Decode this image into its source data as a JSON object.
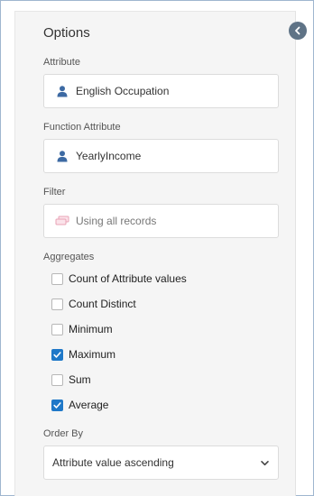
{
  "panel": {
    "title": "Options",
    "attribute": {
      "label": "Attribute",
      "value": "English Occupation",
      "icon": "user-icon"
    },
    "function_attribute": {
      "label": "Function Attribute",
      "value": "YearlyIncome",
      "icon": "user-icon"
    },
    "filter": {
      "label": "Filter",
      "value": "Using all records",
      "icon": "filter-records-icon"
    },
    "aggregates": {
      "label": "Aggregates",
      "items": [
        {
          "label": "Count of Attribute values",
          "checked": false
        },
        {
          "label": "Count Distinct",
          "checked": false
        },
        {
          "label": "Minimum",
          "checked": false
        },
        {
          "label": "Maximum",
          "checked": true
        },
        {
          "label": "Sum",
          "checked": false
        },
        {
          "label": "Average",
          "checked": true
        }
      ]
    },
    "order_by": {
      "label": "Order By",
      "selected": "Attribute value ascending"
    }
  },
  "colors": {
    "accent": "#1f78c8",
    "collapse_button": "#5f7386",
    "panel_bg": "#f5f5f5"
  }
}
